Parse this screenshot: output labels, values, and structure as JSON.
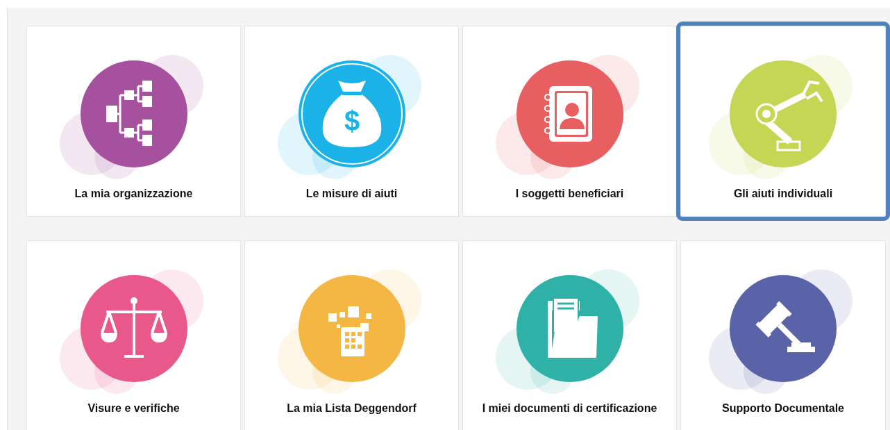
{
  "tiles": [
    {
      "label": "La mia organizzazione",
      "kind": "org_chart",
      "color": "#a5519d",
      "selected": false
    },
    {
      "label": "Le misure di aiuti",
      "kind": "money_bag",
      "color": "#1bb2e8",
      "selected": false,
      "symbol": "$"
    },
    {
      "label": "I soggetti beneficiari",
      "kind": "contacts_book",
      "color": "#e85f61",
      "selected": false
    },
    {
      "label": "Gli aiuti individuali",
      "kind": "robot_arm",
      "color": "#c5d654",
      "selected": true
    },
    {
      "label": "Visure e verifiche",
      "kind": "scales",
      "color": "#e8588a",
      "selected": false
    },
    {
      "label": "La mia Lista Deggendorf",
      "kind": "tablet",
      "color": "#f5b744",
      "selected": false
    },
    {
      "label": "I miei documenti di certificazione",
      "kind": "folder",
      "color": "#2fb1a8",
      "selected": false
    },
    {
      "label": "Supporto Documentale",
      "kind": "gavel",
      "color": "#5a62a8",
      "selected": false
    }
  ]
}
